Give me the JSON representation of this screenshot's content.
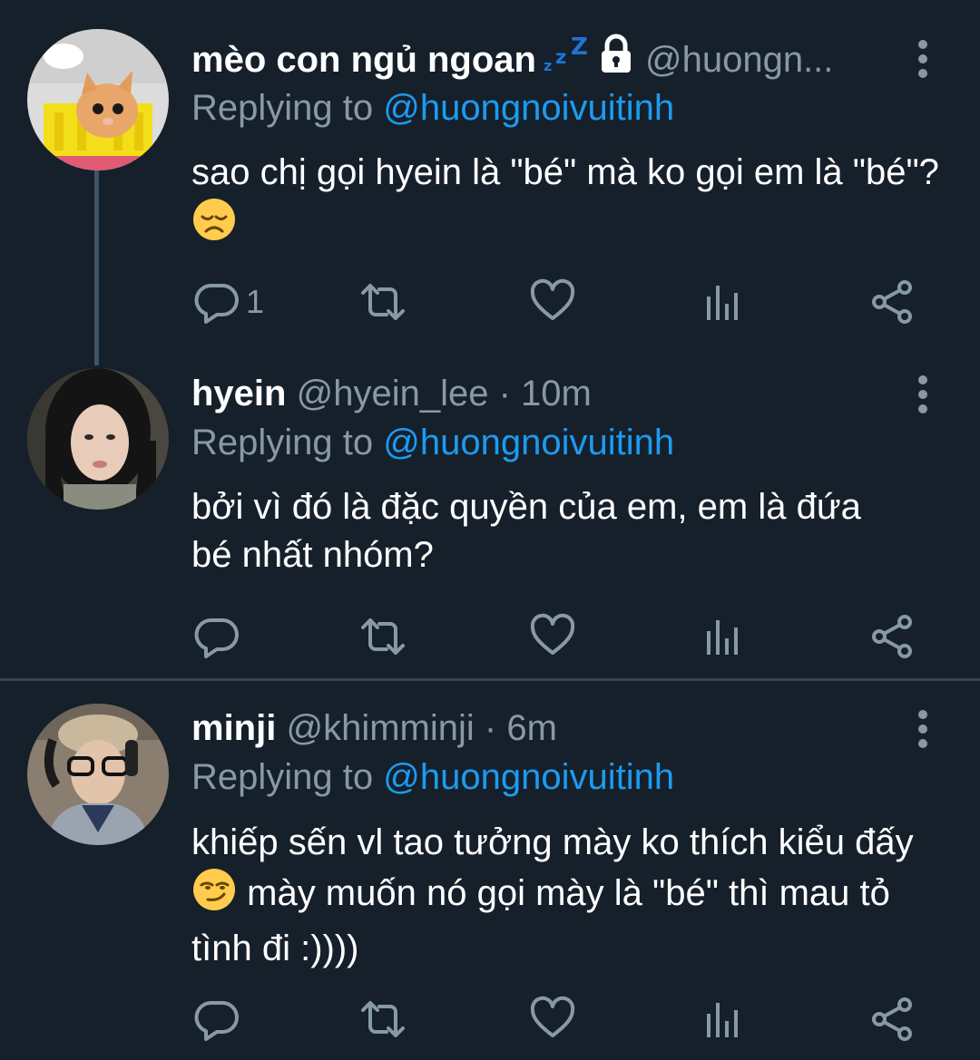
{
  "tweets": [
    {
      "name": "mèo con ngủ ngoan",
      "zzz_icon": "zzz-emoji",
      "lock_icon": "lock-icon",
      "handle": "@huongn...",
      "replying_prefix": "Replying to",
      "replying_to": "@huongnoivuitinh",
      "text_1": "sao chị gọi hyein là \"bé\" mà ko gọi em là \"bé\"?",
      "emoji_1": "disappointed-face-emoji",
      "reply_count": "1"
    },
    {
      "name": "hyein",
      "handle": "@hyein_lee",
      "dot": "·",
      "time": "10m",
      "replying_prefix": "Replying to",
      "replying_to": "@huongnoivuitinh",
      "text_1": "bởi vì đó là đặc quyền của em, em là đứa bé nhất nhóm?"
    },
    {
      "name": "minji",
      "handle": "@khimminji",
      "dot": "·",
      "time": "6m",
      "replying_prefix": "Replying to",
      "replying_to": "@huongnoivuitinh",
      "text_1": "khiếp sến vl tao tưởng mày ko thích kiểu đấy",
      "emoji_1": "smirking-face-emoji",
      "text_2": "mày muốn nó gọi mày là \"bé\" thì mau tỏ tình đi :))))"
    }
  ],
  "colors": {
    "background": "#15202b",
    "secondary_text": "#8899a6",
    "link": "#1d9bf0",
    "divider": "#38444d",
    "thread_line": "#3d5466"
  }
}
